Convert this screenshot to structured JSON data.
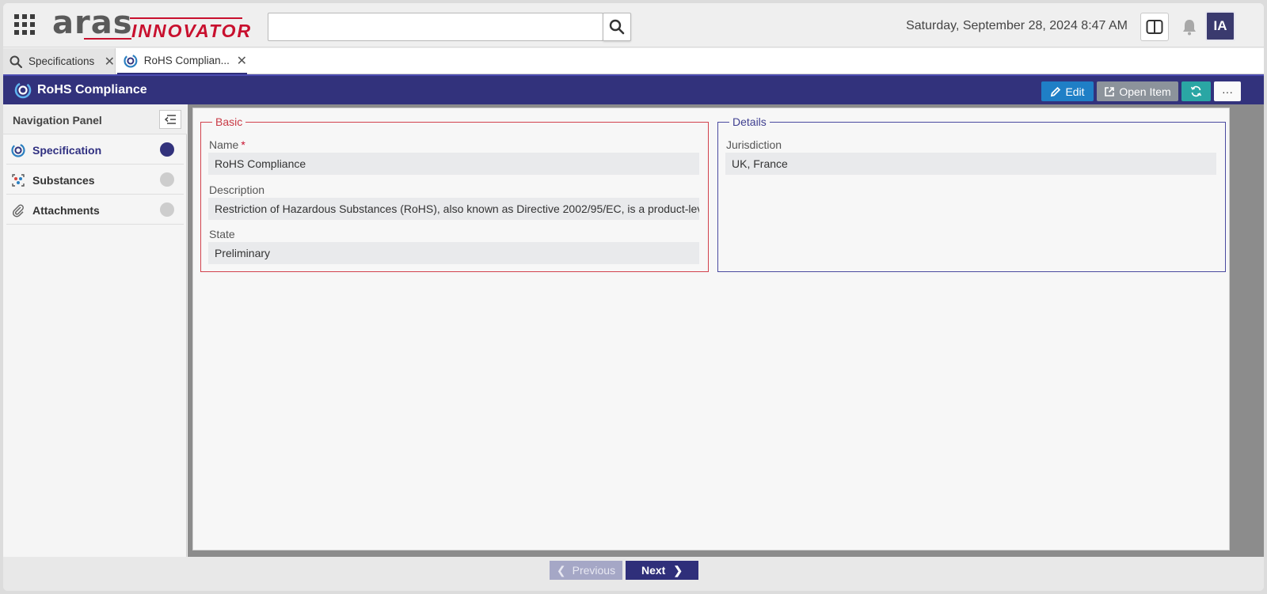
{
  "header": {
    "logo_primary": "aras",
    "logo_secondary": "INNOVATOR",
    "search": {
      "value": "",
      "placeholder": ""
    },
    "datetime": "Saturday, September 28, 2024 8:47 AM",
    "user_initials": "IA"
  },
  "tabs": [
    {
      "label": "Specifications",
      "icon": "search-icon",
      "active": false
    },
    {
      "label": "RoHS Complian...",
      "icon": "specification-icon",
      "active": true
    }
  ],
  "item": {
    "title": "RoHS Compliance",
    "buttons": {
      "edit": "Edit",
      "open_item": "Open Item",
      "refresh_icon": "refresh-icon",
      "more": "···"
    }
  },
  "navigation": {
    "title": "Navigation Panel",
    "items": [
      {
        "label": "Specification",
        "icon": "specification-icon",
        "active": true
      },
      {
        "label": "Substances",
        "icon": "substances-icon",
        "active": false
      },
      {
        "label": "Attachments",
        "icon": "paperclip-icon",
        "active": false
      }
    ]
  },
  "form": {
    "basic": {
      "legend": "Basic",
      "name_label": "Name",
      "name_required": "*",
      "name_value": "RoHS Compliance",
      "description_label": "Description",
      "description_value": "Restriction of Hazardous Substances (RoHS), also known as Directive 2002/95/EC, is a product-level cc",
      "state_label": "State",
      "state_value": "Preliminary"
    },
    "details": {
      "legend": "Details",
      "jurisdiction_label": "Jurisdiction",
      "jurisdiction_value": "UK, France"
    }
  },
  "footer": {
    "previous": "Previous",
    "next": "Next"
  },
  "colors": {
    "brand_dark": "#32327c",
    "logo_red": "#c8102e",
    "edit_blue": "#1f7fc6",
    "refresh_teal": "#2aa6a4",
    "basic_border": "#d2424d",
    "details_border": "#4a4aa0"
  }
}
